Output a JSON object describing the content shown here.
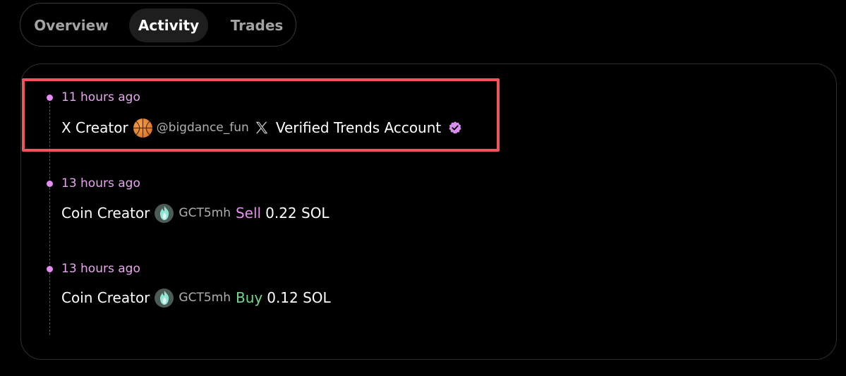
{
  "tabs": [
    {
      "label": "Overview",
      "active": false
    },
    {
      "label": "Activity",
      "active": true
    },
    {
      "label": "Trades",
      "active": false
    }
  ],
  "activity": [
    {
      "time": "11 hours ago",
      "label": "X Creator",
      "avatar_icon": "basketball-avatar",
      "handle": "@bigdance_fun",
      "platform_icon": "x-logo-icon",
      "detail": "Verified Trends Account",
      "detail_icon": "verified-badge-icon"
    },
    {
      "time": "13 hours ago",
      "label": "Coin Creator",
      "avatar_icon": "flame-avatar",
      "handle": "GCT5mh",
      "action": "Sell",
      "amount": "0.22 SOL"
    },
    {
      "time": "13 hours ago",
      "label": "Coin Creator",
      "avatar_icon": "flame-avatar",
      "handle": "GCT5mh",
      "action": "Buy",
      "amount": "0.12 SOL"
    }
  ],
  "colors": {
    "accent_pink": "#e98ff0",
    "buy_green": "#6fda8c",
    "highlight_red": "#f0555f",
    "background": "#000000"
  }
}
